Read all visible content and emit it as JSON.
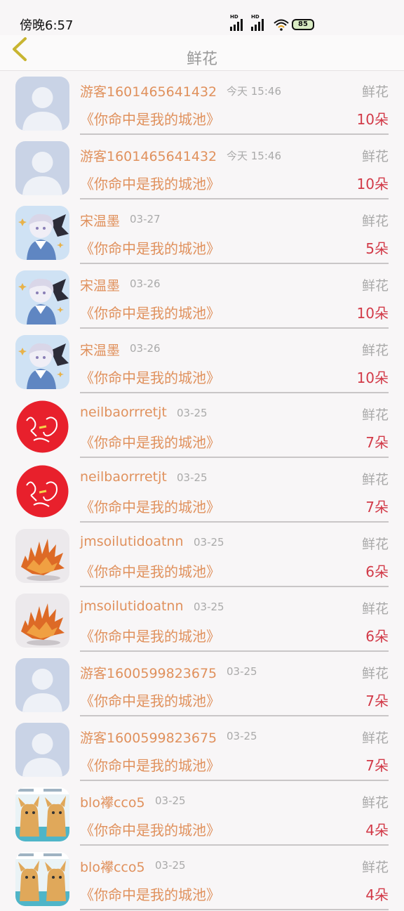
{
  "status_bar": {
    "time": "傍晚6:57",
    "battery": "85"
  },
  "header": {
    "title": "鲜花"
  },
  "rows": [
    {
      "name": "游客1601465641432",
      "time": "今天 15:46",
      "type": "鲜花",
      "book": "《你命中是我的城池》",
      "count": "10朵",
      "avatar": "default"
    },
    {
      "name": "游客1601465641432",
      "time": "今天 15:46",
      "type": "鲜花",
      "book": "《你命中是我的城池》",
      "count": "10朵",
      "avatar": "default"
    },
    {
      "name": "宋温墨",
      "time": "03-27",
      "type": "鲜花",
      "book": "《你命中是我的城池》",
      "count": "5朵",
      "avatar": "anime"
    },
    {
      "name": "宋温墨",
      "time": "03-26",
      "type": "鲜花",
      "book": "《你命中是我的城池》",
      "count": "10朵",
      "avatar": "anime"
    },
    {
      "name": "宋温墨",
      "time": "03-26",
      "type": "鲜花",
      "book": "《你命中是我的城池》",
      "count": "10朵",
      "avatar": "anime"
    },
    {
      "name": "neilbaorrretjt",
      "time": "03-25",
      "type": "鲜花",
      "book": "《你命中是我的城池》",
      "count": "7朵",
      "avatar": "red-seal"
    },
    {
      "name": "neilbaorrretjt",
      "time": "03-25",
      "type": "鲜花",
      "book": "《你命中是我的城池》",
      "count": "7朵",
      "avatar": "red-seal"
    },
    {
      "name": "jmsoilutidoatnn",
      "time": "03-25",
      "type": "鲜花",
      "book": "《你命中是我的城池》",
      "count": "6朵",
      "avatar": "orange-creature"
    },
    {
      "name": "jmsoilutidoatnn",
      "time": "03-25",
      "type": "鲜花",
      "book": "《你命中是我的城池》",
      "count": "6朵",
      "avatar": "orange-creature"
    },
    {
      "name": "游客1600599823675",
      "time": "03-25",
      "type": "鲜花",
      "book": "《你命中是我的城池》",
      "count": "7朵",
      "avatar": "default"
    },
    {
      "name": "游客1600599823675",
      "time": "03-25",
      "type": "鲜花",
      "book": "《你命中是我的城池》",
      "count": "7朵",
      "avatar": "default"
    },
    {
      "name": "blo襻cco5",
      "time": "03-25",
      "type": "鲜花",
      "book": "《你命中是我的城池》",
      "count": "4朵",
      "avatar": "cartoon-dogs"
    },
    {
      "name": "blo襻cco5",
      "time": "03-25",
      "type": "鲜花",
      "book": "《你命中是我的城池》",
      "count": "4朵",
      "avatar": "cartoon-dogs"
    }
  ]
}
